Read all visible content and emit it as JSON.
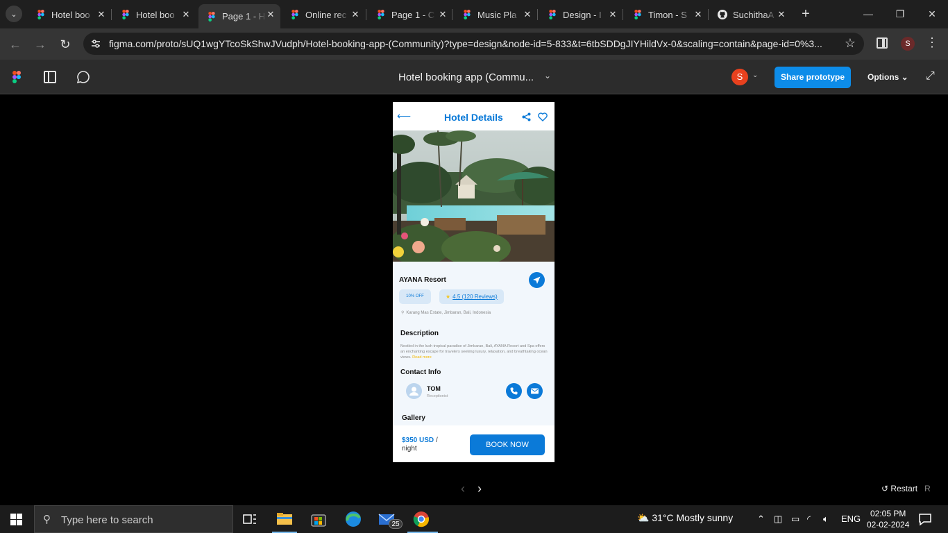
{
  "browser": {
    "tabs": [
      {
        "title": "Hotel boo",
        "active": false
      },
      {
        "title": "Hotel boo",
        "active": false
      },
      {
        "title": "Page 1 - H",
        "active": true
      },
      {
        "title": "Online rec",
        "active": false
      },
      {
        "title": "Page 1 - C",
        "active": false
      },
      {
        "title": "Music Pla",
        "active": false
      },
      {
        "title": "Design - I",
        "active": false
      },
      {
        "title": "Timon - S",
        "active": false
      },
      {
        "title": "SuchithaA",
        "active": false
      }
    ],
    "url": "figma.com/proto/sUQ1wgYTcoSkShwJVudph/Hotel-booking-app-(Community)?type=design&node-id=5-833&t=6tbSDDgJIYHildVx-0&scaling=contain&page-id=0%3...",
    "profile_initial": "S"
  },
  "figma": {
    "file_title": "Hotel booking app (Commu...",
    "user_initial": "S",
    "share_label": "Share prototype",
    "options_label": "Options",
    "restart_label": "Restart",
    "restart_key": "R"
  },
  "app": {
    "header_title": "Hotel Details",
    "hotel_name": "AYANA Resort",
    "discount": "10% OFF",
    "rating": "4.5 (120 Reviews)",
    "location": "Karang Mas Estate, Jimbaran, Bali, Indonesia",
    "description_heading": "Description",
    "description": "Nestled in the lush tropical paradise of Jimbaran, Bali, AYANA Resort and Spa offers an enchanting escape for travelers seeking luxury, relaxation, and breathtaking ocean views.",
    "read_more": "Read more",
    "contact_heading": "Contact Info",
    "contact_name": "TOM",
    "contact_role": "Receptionist",
    "gallery_heading": "Gallery",
    "price": "$350 USD",
    "price_slash": "/",
    "price_unit": "night",
    "book_label": "BOOK NOW"
  },
  "taskbar": {
    "search_placeholder": "Type here to search",
    "mail_badge": "25",
    "weather": "31°C  Mostly sunny",
    "language": "ENG",
    "time": "02:05 PM",
    "date": "02-02-2024"
  },
  "colors": {
    "accent": "#0b7ad8",
    "figma_share": "#0d8ce9",
    "rating_star": "#f3c623"
  }
}
